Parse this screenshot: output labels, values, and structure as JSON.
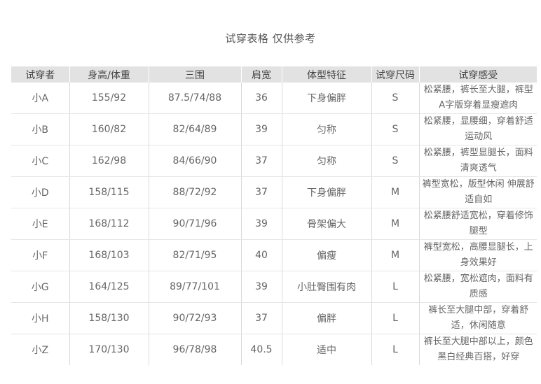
{
  "title": "试穿表格 仅供参考",
  "headers": [
    "试穿者",
    "身高/体重",
    "三围",
    "肩宽",
    "体型特征",
    "试穿尺码",
    "试穿感受"
  ],
  "rows": [
    {
      "name": "小A",
      "hw": "155/92",
      "measure": "87.5/74/88",
      "shoulder": "36",
      "body": "下身偏胖",
      "size": "S",
      "feel": "松紧腰，裤长至大腿，裤型A字版穿着显瘦遮肉"
    },
    {
      "name": "小B",
      "hw": "160/82",
      "measure": "82/64/89",
      "shoulder": "39",
      "body": "匀称",
      "size": "S",
      "feel": "松紧腰，显腰细，穿着舒适运动风"
    },
    {
      "name": "小C",
      "hw": "162/98",
      "measure": "84/66/90",
      "shoulder": "37",
      "body": "匀称",
      "size": "S",
      "feel": "松紧腰，裤型显腿长，面料清爽透气"
    },
    {
      "name": "小D",
      "hw": "158/115",
      "measure": "88/72/92",
      "shoulder": "37",
      "body": "下身偏胖",
      "size": "M",
      "feel": "裤型宽松，版型休闲 伸展舒适自如"
    },
    {
      "name": "小E",
      "hw": "168/112",
      "measure": "90/71/96",
      "shoulder": "39",
      "body": "骨架偏大",
      "size": "M",
      "feel": "松紧腰舒适宽松，穿着修饰腿型"
    },
    {
      "name": "小F",
      "hw": "168/103",
      "measure": "82/71/95",
      "shoulder": "40",
      "body": "偏瘦",
      "size": "M",
      "feel": "裤型宽松，高腰显腿长，上身效果好"
    },
    {
      "name": "小G",
      "hw": "164/125",
      "measure": "89/77/101",
      "shoulder": "39",
      "body": "小肚臀围有肉",
      "size": "L",
      "feel": "松紧腰，宽松遮肉，面料有质感"
    },
    {
      "name": "小H",
      "hw": "158/130",
      "measure": "90/72/93",
      "shoulder": "37",
      "body": "偏胖",
      "size": "L",
      "feel": "裤长至大腿中部，穿着舒适，休闲随意"
    },
    {
      "name": "小Z",
      "hw": "170/130",
      "measure": "96/78/98",
      "shoulder": "40.5",
      "body": "适中",
      "size": "L",
      "feel": "裤长至大腿中部以上，颜色黑白经典百搭，好穿"
    }
  ]
}
